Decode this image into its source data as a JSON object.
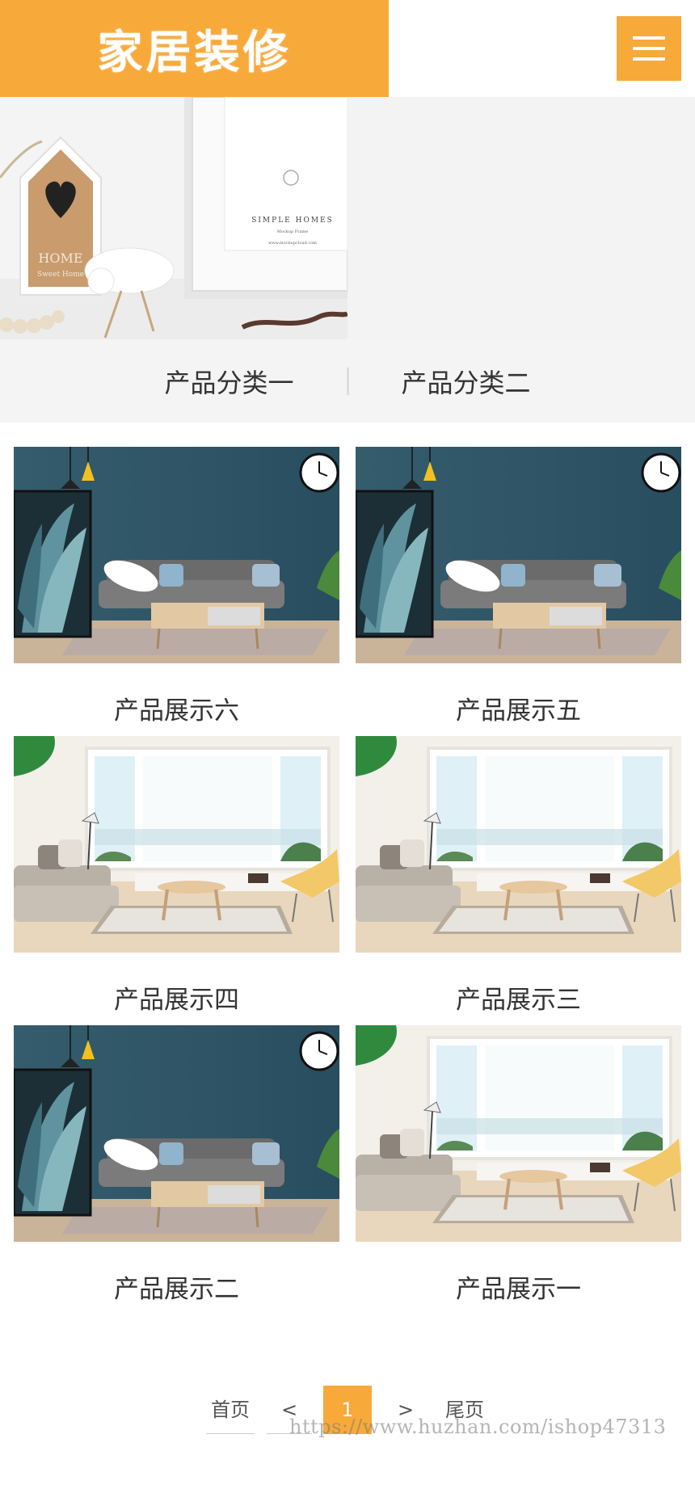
{
  "header": {
    "logo_text": "家居装修",
    "accent_color": "#f7a93a",
    "menu_icon": "hamburger-menu-icon"
  },
  "banner": {
    "brand": "SIMPLE HOMES",
    "sub": "Mockup Frame",
    "url": "www.mockupcloud.com",
    "sign_text": "HOME",
    "sign_sub": "Sweet Home"
  },
  "categories": [
    "产品分类一",
    "产品分类二"
  ],
  "products": [
    {
      "name": "产品展示六",
      "scene": "teal"
    },
    {
      "name": "产品展示五",
      "scene": "teal"
    },
    {
      "name": "产品展示四",
      "scene": "bright"
    },
    {
      "name": "产品展示三",
      "scene": "bright"
    },
    {
      "name": "产品展示二",
      "scene": "teal"
    },
    {
      "name": "产品展示一",
      "scene": "bright"
    }
  ],
  "pagination": {
    "first": "首页",
    "prev": "<",
    "current": "1",
    "next": ">",
    "last": "尾页"
  },
  "watermark": "https://www.huzhan.com/ishop47313"
}
